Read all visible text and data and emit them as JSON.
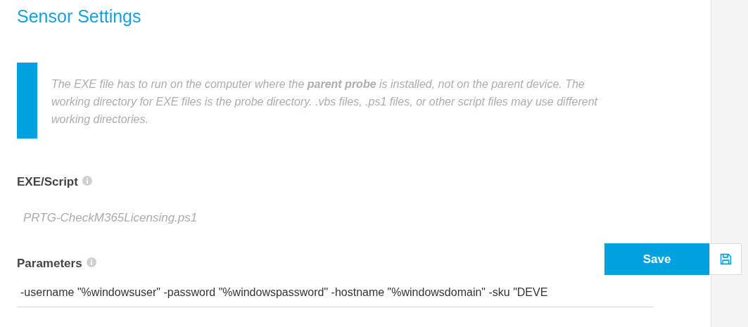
{
  "section_title": "Sensor Settings",
  "info_note": "The EXE file has to run on the computer where the **parent probe** is installed, not on the parent device. The working directory for EXE files is the probe directory. .vbs files, .ps1 files, or other script files may use different working directories.",
  "fields": [
    {
      "kind": "readonly",
      "label": "EXE/Script",
      "value": "PRTG-CheckM365Licensing.ps1"
    },
    {
      "kind": "input",
      "label": "Parameters",
      "value": "-username \"%windowsuser\" -password \"%windowspassword\" -hostname \"%windowsdomain\" -sku \"DEVE"
    }
  ],
  "save_button": {
    "label": "Save"
  }
}
